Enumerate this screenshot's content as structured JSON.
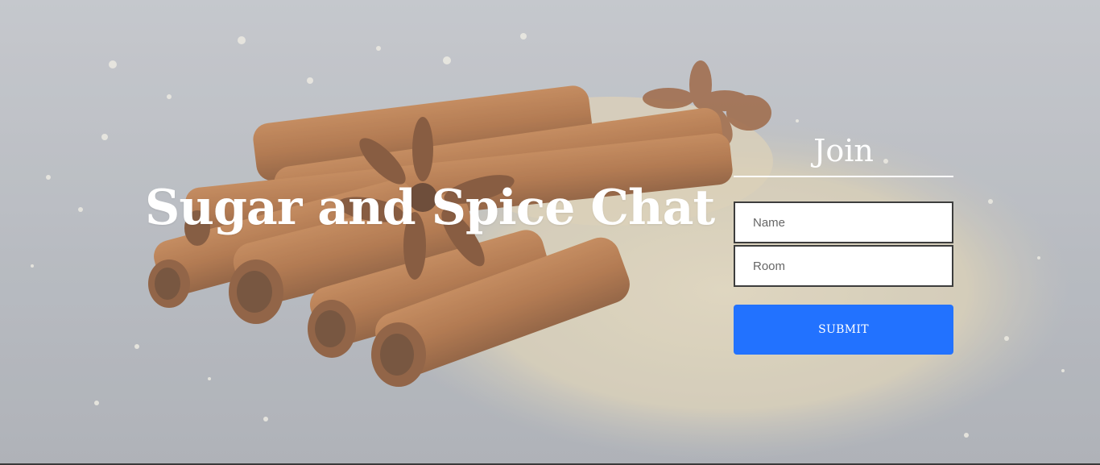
{
  "page": {
    "title": "Sugar and Spice Chat"
  },
  "join_form": {
    "heading": "Join",
    "name_placeholder": "Name",
    "room_placeholder": "Room",
    "submit_label": "SUBMIT"
  },
  "colors": {
    "submit_button": "#2272ff",
    "text": "#ffffff",
    "background": "#b4b7bd"
  }
}
